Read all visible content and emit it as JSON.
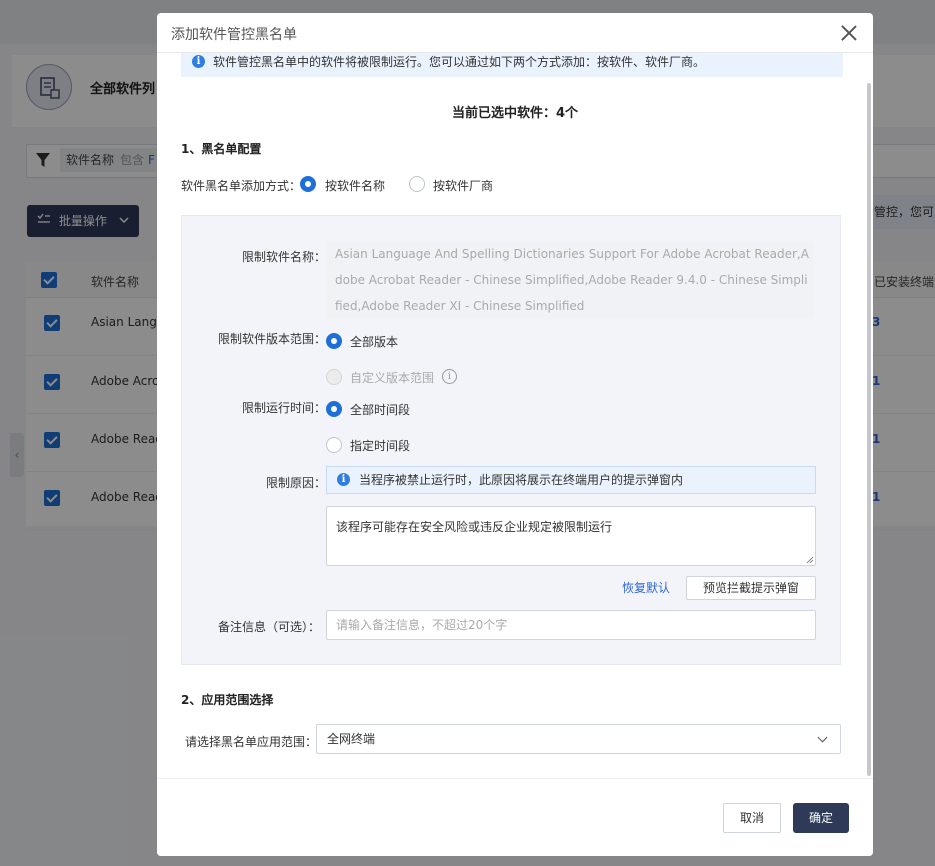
{
  "background": {
    "page_title": "全部软件列",
    "filter": {
      "field": "软件名称",
      "operator": "包含",
      "value": "F"
    },
    "batch_button": "批量操作",
    "notice_fragment": "管控，您可",
    "table": {
      "headers": [
        "软件名称",
        "已安装终端"
      ],
      "rows": [
        {
          "name": "Asian Langu",
          "count": "3"
        },
        {
          "name": "Adobe Acrob",
          "count": "1"
        },
        {
          "name": "Adobe Read",
          "count": "1"
        },
        {
          "name": "Adobe Read",
          "count": "1"
        }
      ]
    },
    "collapse_glyph": "‹"
  },
  "modal": {
    "title": "添加软件管控黑名单",
    "info_banner": "软件管控黑名单中的软件将被限制运行。您可以通过如下两个方式添加：按软件、软件厂商。",
    "selected_count": "当前已选中软件：4个",
    "section1": {
      "title": "1、黑名单配置",
      "add_method_label": "软件黑名单添加方式：",
      "add_method_options": [
        "按软件名称",
        "按软件厂商"
      ],
      "add_method_selected": "按软件名称",
      "restricted_names_label": "限制软件名称：",
      "restricted_names": "Asian Language And Spelling Dictionaries Support For Adobe Acrobat Reader,Adobe Acrobat Reader - Chinese Simplified,Adobe Reader 9.4.0 - Chinese Simplified,Adobe Reader XI - Chinese Simplified",
      "version_range_label": "限制软件版本范围：",
      "version_options": [
        "全部版本",
        "自定义版本范围"
      ],
      "version_selected": "全部版本",
      "run_time_label": "限制运行时间：",
      "run_time_options": [
        "全部时间段",
        "指定时间段"
      ],
      "run_time_selected": "全部时间段",
      "reason_label": "限制原因：",
      "reason_tip": "当程序被禁止运行时，此原因将展示在终端用户的提示弹窗内",
      "reason_text": "该程序可能存在安全风险或违反企业规定被限制运行",
      "restore_default": "恢复默认",
      "preview_button": "预览拦截提示弹窗",
      "remark_label": "备注信息（可选）：",
      "remark_placeholder": "请输入备注信息，不超过20个字"
    },
    "section2": {
      "title": "2、应用范围选择",
      "scope_label": "请选择黑名单应用范围：",
      "scope_value": "全网终端"
    },
    "footer": {
      "cancel": "取消",
      "confirm": "确定"
    }
  },
  "colors": {
    "primary": "#2f3a59",
    "accent": "#1f6fd9",
    "link": "#2f66d6",
    "info_bg": "#eaf3fd"
  }
}
